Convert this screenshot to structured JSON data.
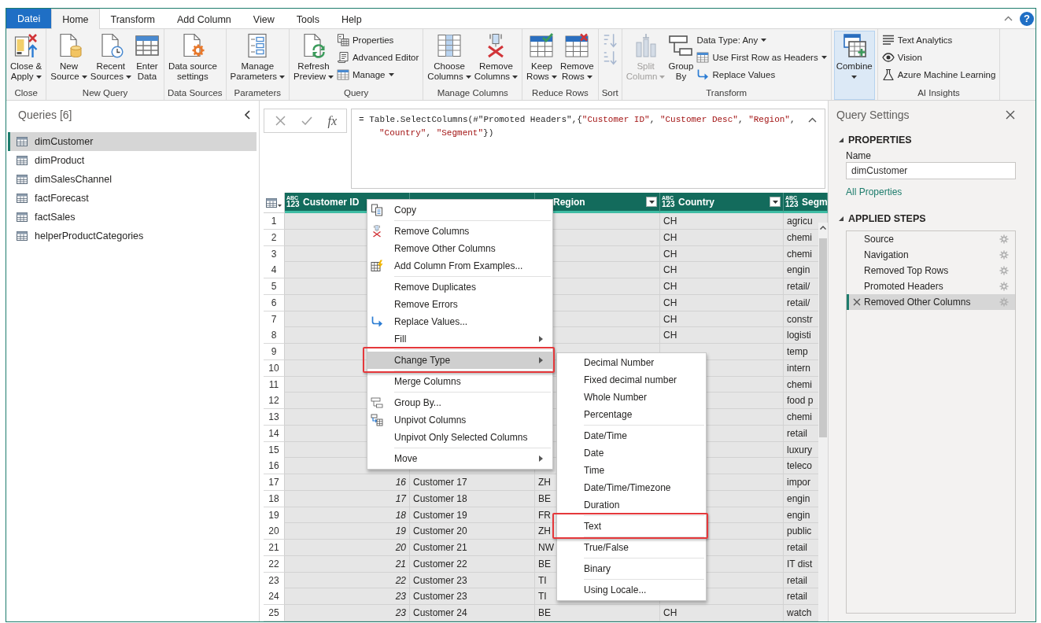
{
  "tabs": [
    {
      "label": "Datei",
      "kind": "file",
      "selected": false
    },
    {
      "label": "Home",
      "kind": "tab",
      "selected": true
    },
    {
      "label": "Transform",
      "kind": "tab",
      "selected": false
    },
    {
      "label": "Add Column",
      "kind": "tab",
      "selected": false
    },
    {
      "label": "View",
      "kind": "tab",
      "selected": false
    },
    {
      "label": "Tools",
      "kind": "tab",
      "selected": false
    },
    {
      "label": "Help",
      "kind": "tab",
      "selected": false
    }
  ],
  "help_button": {
    "label": "?"
  },
  "ribbon": {
    "groups": [
      {
        "label": "Close",
        "large": [
          {
            "kind": "close-apply",
            "lines": [
              "Close &",
              "Apply"
            ],
            "dropdown": true,
            "disabled": false,
            "highlighted": false
          }
        ]
      },
      {
        "label": "New Query",
        "large": [
          {
            "kind": "new-source",
            "lines": [
              "New",
              "Source"
            ],
            "dropdown": true,
            "disabled": false,
            "highlighted": false
          },
          {
            "kind": "recent-sources",
            "lines": [
              "Recent",
              "Sources"
            ],
            "dropdown": true,
            "disabled": false,
            "highlighted": false
          },
          {
            "kind": "enter-data",
            "lines": [
              "Enter",
              "Data"
            ],
            "dropdown": false,
            "disabled": false,
            "highlighted": false
          }
        ]
      },
      {
        "label": "Data Sources",
        "large": [
          {
            "kind": "data-source-settings",
            "lines": [
              "Data source",
              "settings"
            ],
            "dropdown": false,
            "disabled": false,
            "highlighted": false
          }
        ]
      },
      {
        "label": "Parameters",
        "large": [
          {
            "kind": "manage-parameters",
            "lines": [
              "Manage",
              "Parameters"
            ],
            "dropdown": true,
            "disabled": false,
            "highlighted": false
          }
        ]
      },
      {
        "label": "Query",
        "large": [
          {
            "kind": "refresh",
            "lines": [
              "Refresh",
              "Preview"
            ],
            "dropdown": true,
            "disabled": false,
            "highlighted": false
          }
        ],
        "small": [
          {
            "kind": "properties",
            "label": "Properties",
            "dropdown": false,
            "disabled": false
          },
          {
            "kind": "advanced-editor",
            "label": "Advanced Editor",
            "dropdown": false,
            "disabled": false
          },
          {
            "kind": "manage",
            "label": "Manage",
            "dropdown": true,
            "disabled": false
          }
        ]
      },
      {
        "label": "Manage Columns",
        "large": [
          {
            "kind": "choose-columns",
            "lines": [
              "Choose",
              "Columns"
            ],
            "dropdown": true,
            "disabled": false,
            "highlighted": false
          },
          {
            "kind": "remove-columns",
            "lines": [
              "Remove",
              "Columns"
            ],
            "dropdown": true,
            "disabled": false,
            "highlighted": false
          }
        ]
      },
      {
        "label": "Reduce Rows",
        "large": [
          {
            "kind": "keep-rows",
            "lines": [
              "Keep",
              "Rows"
            ],
            "dropdown": true,
            "disabled": false,
            "highlighted": false
          },
          {
            "kind": "remove-rows",
            "lines": [
              "Remove",
              "Rows"
            ],
            "dropdown": true,
            "disabled": false,
            "highlighted": false
          }
        ]
      },
      {
        "label": "Sort",
        "small": [
          {
            "kind": "sort-ascending",
            "dropdown": false,
            "disabled": true
          },
          {
            "kind": "sort-descending",
            "dropdown": false,
            "disabled": true
          }
        ]
      },
      {
        "label": "Transform",
        "large": [
          {
            "kind": "split-column",
            "lines": [
              "Split",
              "Column"
            ],
            "dropdown": true,
            "disabled": true,
            "highlighted": false
          },
          {
            "kind": "group-by",
            "lines": [
              "Group",
              "By"
            ],
            "dropdown": false,
            "disabled": false,
            "highlighted": false
          }
        ],
        "small": [
          {
            "kind": "plain",
            "label": "Data Type: Any",
            "dropdown": true,
            "disabled": false
          },
          {
            "kind": "table",
            "label": "Use First Row as Headers",
            "dropdown": true,
            "disabled": false
          },
          {
            "kind": "replace-values",
            "label": "Replace Values",
            "dropdown": false,
            "disabled": false
          }
        ]
      },
      {
        "large": [
          {
            "kind": "combine",
            "lines": [
              "Combine"
            ],
            "dropdown": true,
            "disabled": false,
            "highlighted": true
          }
        ]
      },
      {
        "label": "AI Insights",
        "small": [
          {
            "kind": "text-analytics",
            "label": "Text Analytics",
            "dropdown": false,
            "disabled": false
          },
          {
            "kind": "vision",
            "label": "Vision",
            "dropdown": false,
            "disabled": false
          },
          {
            "kind": "machine-learning",
            "label": "Azure Machine Learning",
            "dropdown": false,
            "disabled": false
          }
        ]
      }
    ]
  },
  "queries": {
    "title": "Queries [6]",
    "items": [
      {
        "label": "dimCustomer",
        "selected": true
      },
      {
        "label": "dimProduct",
        "selected": false
      },
      {
        "label": "dimSalesChannel",
        "selected": false
      },
      {
        "label": "factForecast",
        "selected": false
      },
      {
        "label": "factSales",
        "selected": false
      },
      {
        "label": "helperProductCategories",
        "selected": false
      }
    ]
  },
  "formula_bar": {
    "fx_label": "fx",
    "lines": [
      [
        {
          "kind": "code",
          "text": "= Table.SelectColumns(#\"Promoted Headers\",{"
        },
        {
          "kind": "string",
          "text": "\"Customer ID\""
        },
        {
          "kind": "code",
          "text": ", "
        },
        {
          "kind": "string",
          "text": "\"Customer Desc\""
        },
        {
          "kind": "code",
          "text": ", "
        },
        {
          "kind": "string",
          "text": "\"Region\""
        },
        {
          "kind": "code",
          "text": ","
        }
      ],
      [
        {
          "kind": "string",
          "text": "\"Country\""
        },
        {
          "kind": "code",
          "text": ", "
        },
        {
          "kind": "string",
          "text": "\"Segment\""
        },
        {
          "kind": "code",
          "text": "})"
        }
      ]
    ]
  },
  "grid": {
    "columns": [
      {
        "type": [
          "ABC",
          "123"
        ],
        "label": "Customer ID",
        "kind": "number",
        "filter_button": false
      },
      {
        "kind": "text",
        "filter_button": false
      },
      {
        "label": "Region",
        "kind": "text",
        "filter_button": true
      },
      {
        "type": [
          "ABC",
          "123"
        ],
        "label": "Country",
        "kind": "text",
        "filter_button": true
      },
      {
        "type": [
          "ABC",
          "123"
        ],
        "label": "Segm",
        "kind": "text",
        "filter_button": false
      }
    ],
    "rows": [
      {
        "number": "1",
        "cells": [
          null,
          null,
          null,
          "CH",
          "agricu"
        ]
      },
      {
        "number": "2",
        "cells": [
          null,
          null,
          null,
          "CH",
          "chemi"
        ]
      },
      {
        "number": "3",
        "cells": [
          null,
          null,
          null,
          "CH",
          "chemi"
        ]
      },
      {
        "number": "4",
        "cells": [
          null,
          null,
          null,
          "CH",
          "engin"
        ]
      },
      {
        "number": "5",
        "cells": [
          null,
          null,
          null,
          "CH",
          "retail/"
        ]
      },
      {
        "number": "6",
        "cells": [
          null,
          null,
          null,
          "CH",
          "retail/"
        ]
      },
      {
        "number": "7",
        "cells": [
          null,
          null,
          null,
          "CH",
          "constr"
        ]
      },
      {
        "number": "8",
        "cells": [
          null,
          null,
          null,
          "CH",
          "logisti"
        ]
      },
      {
        "number": "9",
        "cells": [
          null,
          null,
          null,
          null,
          "temp"
        ]
      },
      {
        "number": "10",
        "cells": [
          null,
          null,
          null,
          null,
          "intern"
        ]
      },
      {
        "number": "11",
        "cells": [
          null,
          null,
          null,
          null,
          "chemi"
        ]
      },
      {
        "number": "12",
        "cells": [
          null,
          null,
          null,
          null,
          "food p"
        ]
      },
      {
        "number": "13",
        "cells": [
          null,
          null,
          null,
          null,
          "chemi"
        ]
      },
      {
        "number": "14",
        "cells": [
          null,
          null,
          null,
          null,
          "retail"
        ]
      },
      {
        "number": "15",
        "cells": [
          null,
          null,
          null,
          null,
          "luxury"
        ]
      },
      {
        "number": "16",
        "cells": [
          null,
          null,
          null,
          null,
          "teleco"
        ]
      },
      {
        "number": "17",
        "cells": [
          "16",
          "Customer 17",
          "ZH",
          null,
          "impor"
        ]
      },
      {
        "number": "18",
        "cells": [
          "17",
          "Customer 18",
          "BE",
          null,
          "engin"
        ]
      },
      {
        "number": "19",
        "cells": [
          "18",
          "Customer 19",
          "FR",
          null,
          "engin"
        ]
      },
      {
        "number": "20",
        "cells": [
          "19",
          "Customer 20",
          "ZH",
          null,
          "public"
        ]
      },
      {
        "number": "21",
        "cells": [
          "20",
          "Customer 21",
          "NW",
          null,
          "retail"
        ]
      },
      {
        "number": "22",
        "cells": [
          "21",
          "Customer 22",
          "BE",
          null,
          "IT dist"
        ]
      },
      {
        "number": "23",
        "cells": [
          "22",
          "Customer 23",
          "TI",
          null,
          "retail"
        ]
      },
      {
        "number": "24",
        "cells": [
          "23",
          "Customer 23",
          "TI",
          null,
          "retail"
        ]
      },
      {
        "number": "25",
        "cells": [
          "23",
          "Customer 24",
          "BE",
          "CH",
          "watch"
        ]
      }
    ]
  },
  "query_settings": {
    "title": "Query Settings",
    "properties": {
      "header": "PROPERTIES",
      "name_label": "Name",
      "name_value": "dimCustomer",
      "all_properties_link": "All Properties"
    },
    "applied_steps": {
      "header": "APPLIED STEPS",
      "steps": [
        {
          "label": "Source",
          "selected": false
        },
        {
          "label": "Navigation",
          "selected": false
        },
        {
          "label": "Removed Top Rows",
          "selected": false
        },
        {
          "label": "Promoted Headers",
          "selected": false
        },
        {
          "label": "Removed Other Columns",
          "selected": true
        }
      ]
    }
  },
  "context_menu": {
    "groups": [
      {
        "items": [
          {
            "label": "Copy",
            "kind": "copy",
            "submenu": false,
            "highlighted": false,
            "annotated": false
          }
        ]
      },
      {
        "items": [
          {
            "label": "Remove Columns",
            "kind": "remove-columns",
            "submenu": false,
            "highlighted": false,
            "annotated": false
          },
          {
            "label": "Remove Other Columns",
            "kind": "plain",
            "submenu": false,
            "highlighted": false,
            "annotated": false
          },
          {
            "label": "Add Column From Examples...",
            "kind": "column-from-examples",
            "submenu": false,
            "highlighted": false,
            "annotated": false
          }
        ]
      },
      {
        "items": [
          {
            "label": "Remove Duplicates",
            "kind": "plain",
            "submenu": false,
            "highlighted": false,
            "annotated": false
          },
          {
            "label": "Remove Errors",
            "kind": "plain",
            "submenu": false,
            "highlighted": false,
            "annotated": false
          },
          {
            "label": "Replace Values...",
            "kind": "replace-values",
            "submenu": false,
            "highlighted": false,
            "annotated": false
          },
          {
            "label": "Fill",
            "kind": "plain",
            "submenu": true,
            "highlighted": false,
            "annotated": false
          }
        ]
      },
      {
        "items": [
          {
            "label": "Change Type",
            "kind": "plain",
            "submenu": true,
            "highlighted": true,
            "annotated": true
          }
        ]
      },
      {
        "items": [
          {
            "label": "Merge Columns",
            "kind": "plain",
            "submenu": false,
            "highlighted": false,
            "annotated": false
          }
        ]
      },
      {
        "items": [
          {
            "label": "Group By...",
            "kind": "group-by",
            "submenu": false,
            "highlighted": false,
            "annotated": false
          },
          {
            "label": "Unpivot Columns",
            "kind": "unpivot",
            "submenu": false,
            "highlighted": false,
            "annotated": false
          },
          {
            "label": "Unpivot Only Selected Columns",
            "kind": "plain",
            "submenu": false,
            "highlighted": false,
            "annotated": false
          }
        ]
      },
      {
        "items": [
          {
            "label": "Move",
            "kind": "plain",
            "submenu": true,
            "highlighted": false,
            "annotated": false
          }
        ]
      }
    ]
  },
  "change_type_menu": {
    "groups": [
      {
        "items": [
          {
            "label": "Decimal Number",
            "submenu": false,
            "highlighted": false,
            "annotated": false
          },
          {
            "label": "Fixed decimal number",
            "submenu": false,
            "highlighted": false,
            "annotated": false
          },
          {
            "label": "Whole Number",
            "submenu": false,
            "highlighted": false,
            "annotated": false
          },
          {
            "label": "Percentage",
            "submenu": false,
            "highlighted": false,
            "annotated": false
          }
        ]
      },
      {
        "items": [
          {
            "label": "Date/Time",
            "submenu": false,
            "highlighted": false,
            "annotated": false
          },
          {
            "label": "Date",
            "submenu": false,
            "highlighted": false,
            "annotated": false
          },
          {
            "label": "Time",
            "submenu": false,
            "highlighted": false,
            "annotated": false
          },
          {
            "label": "Date/Time/Timezone",
            "submenu": false,
            "highlighted": false,
            "annotated": false
          },
          {
            "label": "Duration",
            "submenu": false,
            "highlighted": false,
            "annotated": false
          }
        ]
      },
      {
        "items": [
          {
            "label": "Text",
            "submenu": false,
            "highlighted": false,
            "annotated": true
          }
        ]
      },
      {
        "items": [
          {
            "label": "True/False",
            "submenu": false,
            "highlighted": false,
            "annotated": false
          }
        ]
      },
      {
        "items": [
          {
            "label": "Binary",
            "submenu": false,
            "highlighted": false,
            "annotated": false
          }
        ]
      },
      {
        "items": [
          {
            "label": "Using Locale...",
            "submenu": false,
            "highlighted": false,
            "annotated": false
          }
        ]
      }
    ]
  }
}
